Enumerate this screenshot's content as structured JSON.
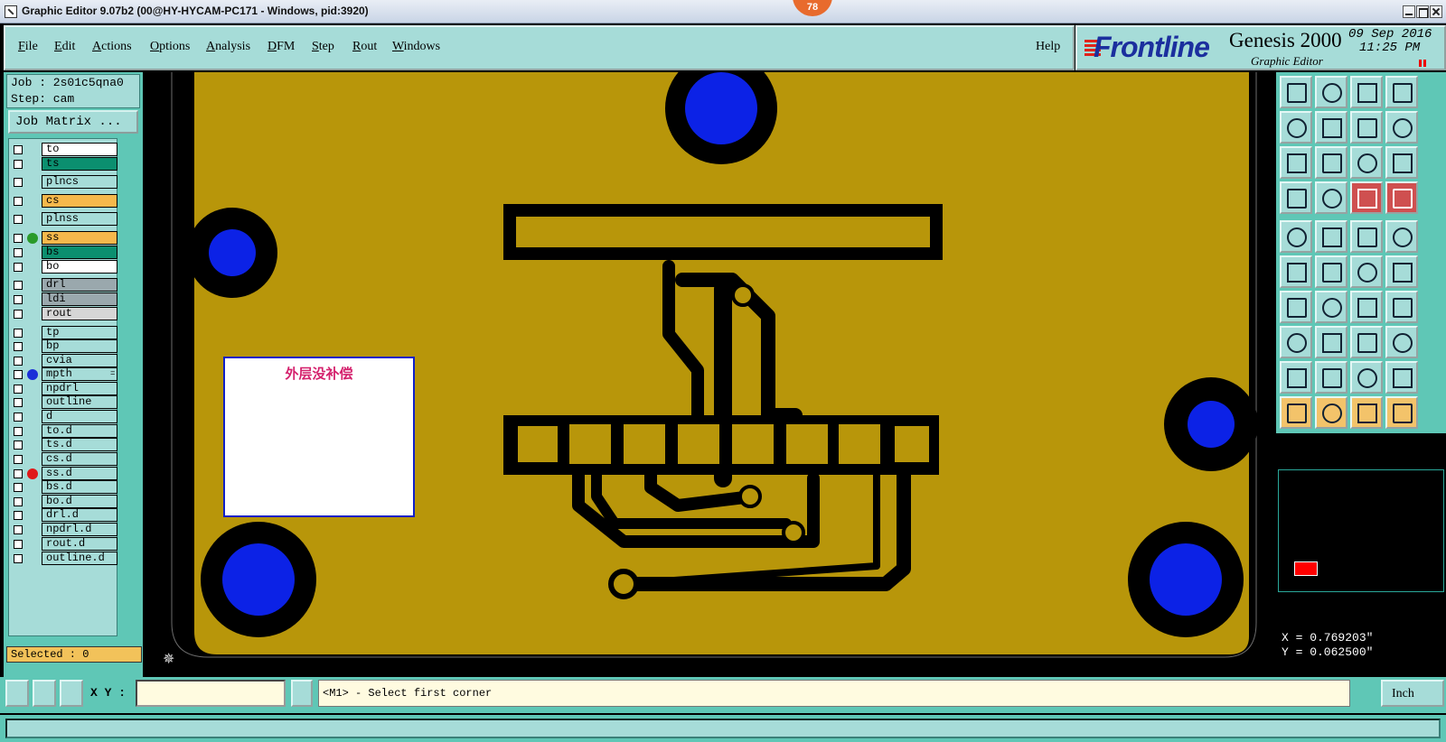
{
  "window": {
    "title": "Graphic Editor 9.07b2 (00@HY-HYCAM-PC171 - Windows, pid:3920)",
    "badge": "78"
  },
  "menu": {
    "items": [
      "File",
      "Edit",
      "Actions",
      "Options",
      "Analysis",
      "DFM",
      "Step",
      "Rout",
      "Windows"
    ],
    "help": "Help"
  },
  "brand": {
    "logo": "Frontline",
    "product": "Genesis 2000",
    "subtitle": "Graphic Editor",
    "date": "09 Sep 2016",
    "time": "11:25 PM"
  },
  "job": {
    "job_line": "Job : 2s01c5qna0",
    "step_line": "Step: cam",
    "matrix_button": "Job Matrix ..."
  },
  "layers": [
    {
      "name": "to",
      "color": "#ffffff",
      "dot": ""
    },
    {
      "name": "ts",
      "color": "#0b8f6f",
      "dot": ""
    },
    {
      "name": "plncs",
      "color": "#a6dcd8",
      "dot": ""
    },
    {
      "name": "cs",
      "color": "#f5b84c",
      "dot": ""
    },
    {
      "name": "plnss",
      "color": "#a6dcd8",
      "dot": ""
    },
    {
      "name": "ss",
      "color": "#f5b84c",
      "dot": "#2a9a2a"
    },
    {
      "name": "bs",
      "color": "#0b8f6f",
      "dot": ""
    },
    {
      "name": "bo",
      "color": "#ffffff",
      "dot": ""
    },
    {
      "name": "drl",
      "color": "#9aa8ad",
      "dot": ""
    },
    {
      "name": "ldi",
      "color": "#9aa8ad",
      "dot": ""
    },
    {
      "name": "rout",
      "color": "#d6d6d6",
      "dot": ""
    },
    {
      "name": "tp",
      "color": "#a6dcd8",
      "dot": ""
    },
    {
      "name": "bp",
      "color": "#a6dcd8",
      "dot": ""
    },
    {
      "name": "cvia",
      "color": "#a6dcd8",
      "dot": ""
    },
    {
      "name": "mpth",
      "color": "#a6dcd8",
      "dot": "#1a2fd8",
      "extra": "="
    },
    {
      "name": "npdrl",
      "color": "#a6dcd8",
      "dot": ""
    },
    {
      "name": "outline",
      "color": "#a6dcd8",
      "dot": ""
    },
    {
      "name": "d",
      "color": "#a6dcd8",
      "dot": ""
    },
    {
      "name": "to.d",
      "color": "#a6dcd8",
      "dot": ""
    },
    {
      "name": "ts.d",
      "color": "#a6dcd8",
      "dot": ""
    },
    {
      "name": "cs.d",
      "color": "#a6dcd8",
      "dot": ""
    },
    {
      "name": "ss.d",
      "color": "#a6dcd8",
      "dot": "#e01818"
    },
    {
      "name": "bs.d",
      "color": "#a6dcd8",
      "dot": ""
    },
    {
      "name": "bo.d",
      "color": "#a6dcd8",
      "dot": ""
    },
    {
      "name": "drl.d",
      "color": "#a6dcd8",
      "dot": ""
    },
    {
      "name": "npdrl.d",
      "color": "#a6dcd8",
      "dot": ""
    },
    {
      "name": "rout.d",
      "color": "#a6dcd8",
      "dot": ""
    },
    {
      "name": "outline.d",
      "color": "#a6dcd8",
      "dot": ""
    }
  ],
  "selected_label": "Selected : 0",
  "canvas": {
    "note": "外层没补偿",
    "copper_color": "#b8960a",
    "pad_color": "#0c22e6"
  },
  "coords": {
    "x": "X = 0.769203\"",
    "y": "Y = 0.062500\""
  },
  "bottom": {
    "xy_label": "X Y :",
    "xy_value": "",
    "prompt": "<M1> - Select first corner",
    "units": "Inch"
  },
  "tools": [
    "pan-up-icon",
    "pan-down-icon",
    "home-icon",
    "zoom-window-icon",
    "pan-left-icon",
    "pan-right-icon",
    "undo-icon",
    "redo-icon",
    "zoom-fit-icon",
    "zoom-step-icon",
    "scale-1-2-icon",
    "help-icon",
    "snap-icon",
    "grid-icon",
    "layers-red-icon",
    "layers-red-alt-icon",
    "feature-info-icon",
    "measure-icon",
    "ruler-icon",
    "highlight-icon",
    "connect-icon",
    "delete-node-icon",
    "move-icon",
    "copy-icon",
    "line-edit-icon",
    "draw-line-icon",
    "arc-icon",
    "mirror-icon",
    "select-area-icon",
    "break-icon",
    "stretch-icon",
    "group-icon",
    "text-a-icon",
    "text-b-icon",
    "text-c-icon",
    "text-d-icon",
    "pointer-icon",
    "pointer-box-icon",
    "pointer-poly-icon",
    "net-icon"
  ]
}
